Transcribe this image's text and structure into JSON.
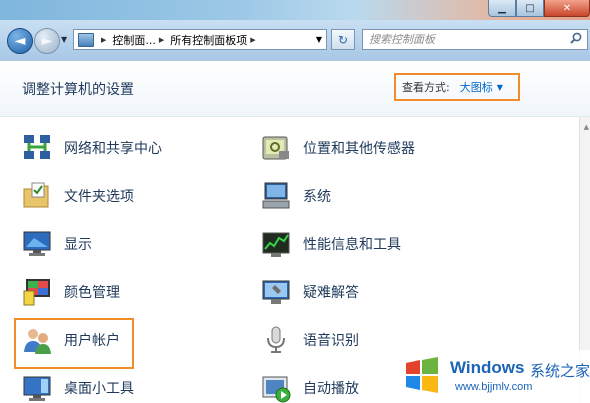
{
  "window": {
    "minimize_symbol": "▁",
    "maximize_symbol": "□",
    "close_symbol": "✕"
  },
  "addressbar": {
    "back_symbol": "◄",
    "forward_symbol": "►",
    "history_symbol": "▼",
    "breadcrumbs": [
      "控制面...",
      "所有控制面板项"
    ],
    "path_dropdown_symbol": "▼",
    "refresh_symbol": "↻",
    "search_placeholder": "搜索控制面板",
    "search_icon": "magnifier-icon"
  },
  "header": {
    "title": "调整计算机的设置",
    "view_by_label": "查看方式:",
    "view_by_value": "大图标",
    "view_by_arrow": "▼"
  },
  "items": [
    {
      "label": "网络和共享中心",
      "icon": "network-icon"
    },
    {
      "label": "位置和其他传感器",
      "icon": "sensor-icon"
    },
    {
      "label": "文件夹选项",
      "icon": "folder-options-icon"
    },
    {
      "label": "系统",
      "icon": "system-icon"
    },
    {
      "label": "显示",
      "icon": "display-icon"
    },
    {
      "label": "性能信息和工具",
      "icon": "performance-icon"
    },
    {
      "label": "颜色管理",
      "icon": "color-management-icon"
    },
    {
      "label": "疑难解答",
      "icon": "troubleshooting-icon"
    },
    {
      "label": "用户帐户",
      "icon": "user-accounts-icon"
    },
    {
      "label": "语音识别",
      "icon": "microphone-icon"
    },
    {
      "label": "桌面小工具",
      "icon": "gadgets-icon"
    },
    {
      "label": "自动播放",
      "icon": "autoplay-icon"
    }
  ],
  "watermark": {
    "brand": "Windows",
    "name_cn": "系统之家",
    "url": "www.bjjmlv.com"
  },
  "colors": {
    "link_text": "#1e395b",
    "accent_link": "#0066cc",
    "highlight_border": "#f08c2a",
    "watermark_blue": "#1b64b7"
  }
}
